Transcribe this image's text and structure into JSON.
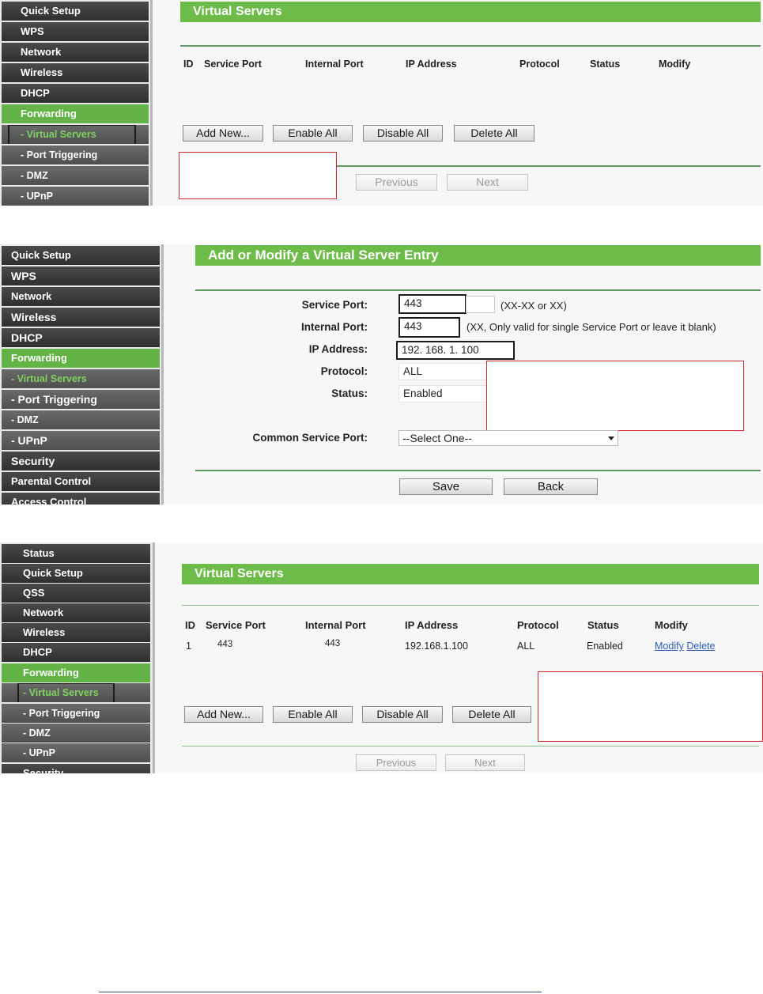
{
  "panel1": {
    "menu": [
      "Quick Setup",
      "WPS",
      "Network",
      "Wireless",
      "DHCP",
      "Forwarding",
      "- Virtual Servers",
      "- Port Triggering",
      "- DMZ",
      "- UPnP"
    ],
    "title": "Virtual Servers",
    "columns": [
      "ID",
      "Service Port",
      "Internal Port",
      "IP Address",
      "Protocol",
      "Status",
      "Modify"
    ],
    "buttons": {
      "add_new": "Add New...",
      "enable_all": "Enable All",
      "disable_all": "Disable All",
      "delete_all": "Delete All"
    },
    "pager": {
      "previous": "Previous",
      "next": "Next"
    }
  },
  "panel2": {
    "menu": [
      "Quick Setup",
      "WPS",
      "Network",
      "Wireless",
      "DHCP",
      "Forwarding",
      "- Virtual Servers",
      "- Port Triggering",
      "- DMZ",
      "- UPnP",
      "Security",
      "Parental Control",
      "Access Control"
    ],
    "title": "Add or Modify a Virtual Server Entry",
    "fields": {
      "service_port": {
        "label": "Service Port:",
        "value": "443",
        "hint": "(XX-XX or XX)"
      },
      "internal_port": {
        "label": "Internal Port:",
        "value": "443",
        "hint": "(XX, Only valid for single Service Port or leave it blank)"
      },
      "ip_address": {
        "label": "IP Address:",
        "value": "192. 168. 1. 100"
      },
      "protocol": {
        "label": "Protocol:",
        "value": "ALL"
      },
      "status": {
        "label": "Status:",
        "value": "Enabled"
      },
      "common_service_port": {
        "label": "Common Service Port:",
        "value": "--Select One--"
      }
    },
    "buttons": {
      "save": "Save",
      "back": "Back"
    }
  },
  "panel3": {
    "menu": [
      "Status",
      "Quick Setup",
      "QSS",
      "Network",
      "Wireless",
      "DHCP",
      "Forwarding",
      "- Virtual Servers",
      "- Port Triggering",
      "- DMZ",
      "- UPnP",
      "Security"
    ],
    "title": "Virtual Servers",
    "columns": [
      "ID",
      "Service Port",
      "Internal Port",
      "IP Address",
      "Protocol",
      "Status",
      "Modify"
    ],
    "row": {
      "id": "1",
      "service_port": "443",
      "internal_port": "443",
      "ip_address": "192.168.1.100",
      "protocol": "ALL",
      "status": "Enabled",
      "modify": "Modify",
      "delete": "Delete"
    },
    "buttons": {
      "add_new": "Add New...",
      "enable_all": "Enable All",
      "disable_all": "Disable All",
      "delete_all": "Delete All"
    },
    "pager": {
      "previous": "Previous",
      "next": "Next"
    }
  },
  "colors": {
    "accent_green": "#6dbb48",
    "menu_dark": "#3a3a3a",
    "highlight_red": "#d7262b",
    "link_blue": "#2c5db9"
  }
}
